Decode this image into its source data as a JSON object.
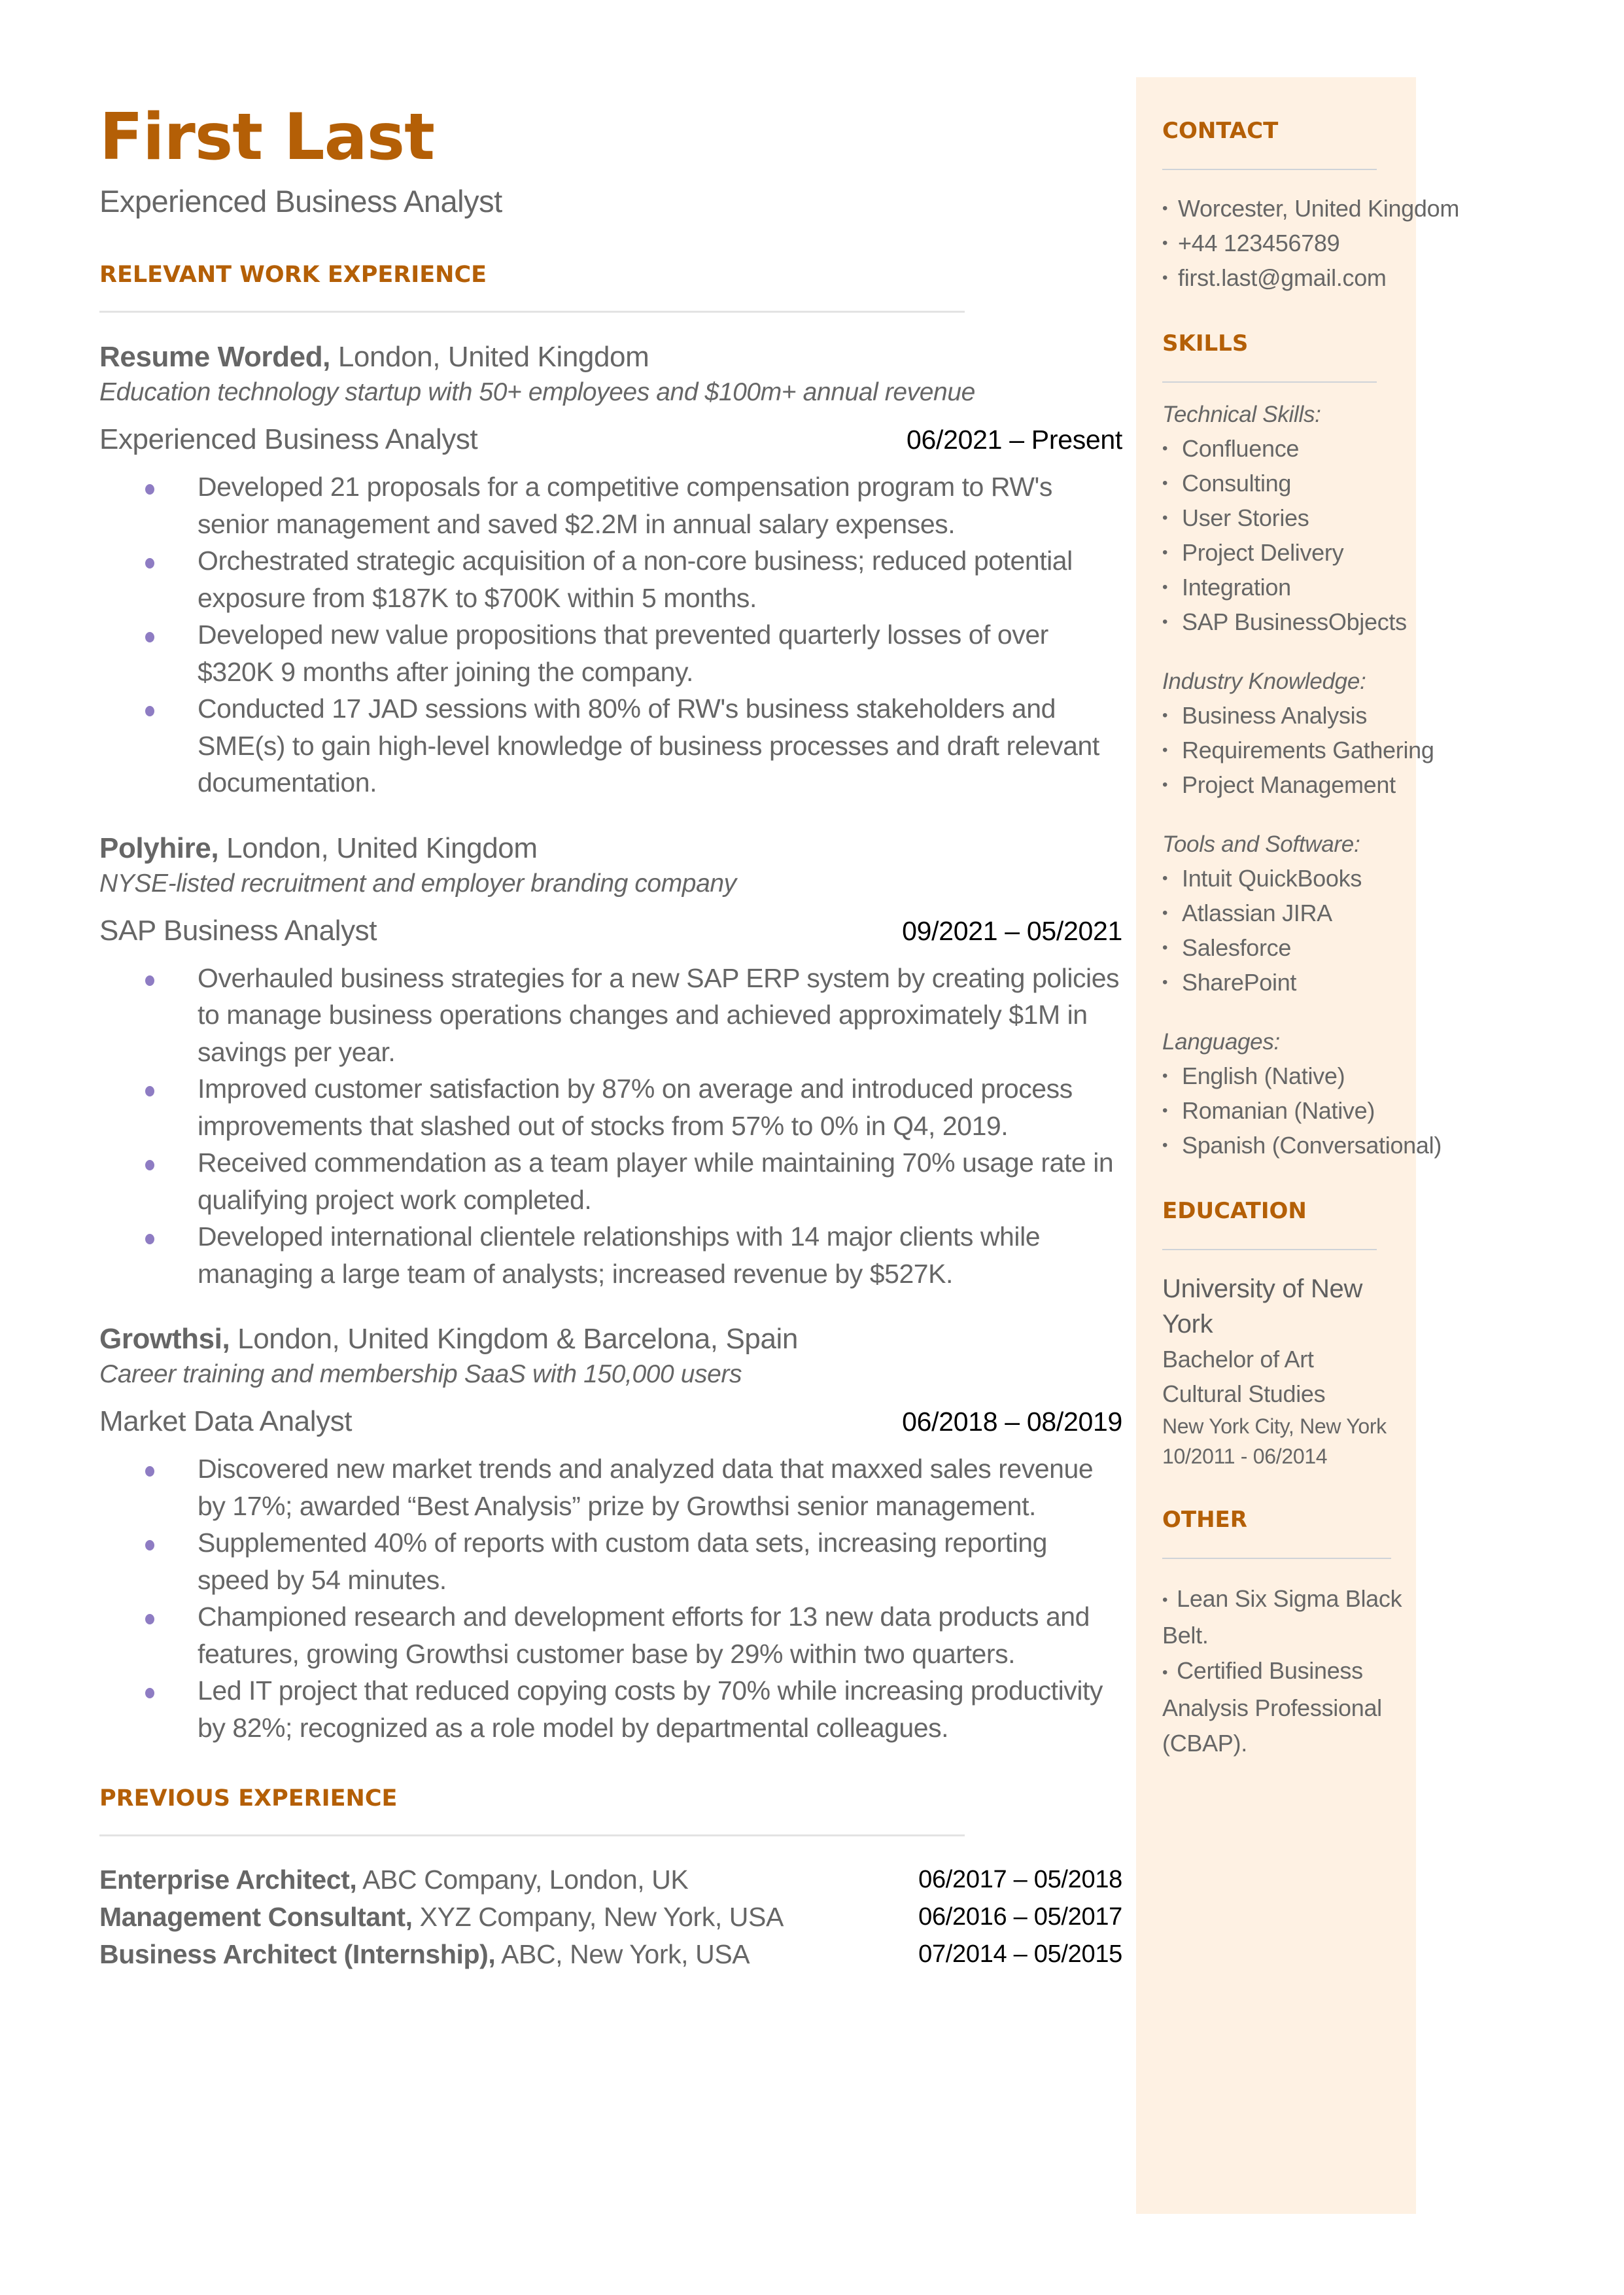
{
  "header": {
    "name": "First Last",
    "title": "Experienced Business Analyst"
  },
  "colors": {
    "accent": "#B45F06",
    "text": "#666666",
    "bullet": "#8E7CC3",
    "sidebar_bg": "#FEF1E3",
    "divider": "#E3E3E3"
  },
  "work": {
    "heading": "RELEVANT WORK EXPERIENCE",
    "jobs": [
      {
        "company": "Resume Worded,",
        "location": " London, United Kingdom",
        "description": "Education technology startup with 50+ employees and $100m+ annual revenue",
        "role": "Experienced Business Analyst",
        "dates": "06/2021 – Present",
        "bullets": [
          "Developed 21 proposals for a competitive compensation program to RW's senior management and saved $2.2M in annual salary expenses.",
          "Orchestrated strategic acquisition of a non-core business; reduced potential exposure from $187K to $700K within 5 months.",
          "Developed new value propositions that prevented quarterly losses of over $320K 9 months after joining the company.",
          "Conducted 17 JAD sessions with 80% of RW's business stakeholders and SME(s) to gain high-level knowledge of business processes and draft relevant documentation."
        ]
      },
      {
        "company": "Polyhire,",
        "location": " London, United Kingdom",
        "description": "NYSE-listed recruitment and employer branding company",
        "role": "SAP Business Analyst",
        "dates": "09/2021 – 05/2021",
        "bullets": [
          "Overhauled business strategies for a new SAP ERP system by creating policies to manage business operations changes and achieved approximately $1M in savings per year.",
          "Improved customer satisfaction by 87% on average and introduced process improvements that slashed out of stocks from 57% to 0% in Q4, 2019.",
          "Received commendation as a team player while maintaining 70% usage rate in qualifying project work completed.",
          "Developed international clientele relationships with 14 major clients while managing a large team of analysts; increased revenue by $527K."
        ]
      },
      {
        "company": "Growthsi,",
        "location": " London, United Kingdom & Barcelona, Spain",
        "description": "Career training and membership SaaS with 150,000 users",
        "role": "Market Data Analyst",
        "dates": "06/2018 – 08/2019",
        "bullets": [
          "Discovered new market trends and analyzed data that maxxed sales revenue by 17%; awarded “Best Analysis” prize by Growthsi senior management.",
          "Supplemented 40% of reports with custom data sets, increasing reporting speed by 54 minutes.",
          "Championed research and development efforts for 13 new data products and features, growing Growthsi customer base by 29% within two quarters.",
          "Led IT project that reduced copying costs by 70% while increasing productivity by 82%; recognized as a role model by departmental colleagues."
        ]
      }
    ]
  },
  "previous": {
    "heading": "PREVIOUS EXPERIENCE",
    "items": [
      {
        "role": "Enterprise Architect,",
        "org": " ABC Company, London, UK",
        "dates": "06/2017 – 05/2018"
      },
      {
        "role": "Management Consultant,",
        "org": " XYZ Company, New York, USA",
        "dates": "06/2016 – 05/2017"
      },
      {
        "role": "Business Architect (Internship),",
        "org": " ABC, New York, USA",
        "dates": "07/2014 – 05/2015"
      }
    ]
  },
  "sidebar": {
    "contact": {
      "heading": "CONTACT",
      "items": [
        "Worcester, United Kingdom",
        "+44 123456789",
        "first.last@gmail.com"
      ]
    },
    "skills": {
      "heading": "SKILLS",
      "groups": [
        {
          "category": "Technical Skills:",
          "items": [
            "Confluence",
            "Consulting",
            "User Stories",
            "Project Delivery",
            "Integration",
            "SAP BusinessObjects"
          ]
        },
        {
          "category": "Industry Knowledge:",
          "items": [
            "Business Analysis",
            "Requirements Gathering",
            "Project Management"
          ]
        },
        {
          "category": "Tools and Software:",
          "items": [
            "Intuit QuickBooks",
            "Atlassian JIRA",
            "Salesforce",
            "SharePoint"
          ]
        },
        {
          "category": "Languages:",
          "items": [
            "English (Native)",
            "Romanian (Native)",
            "Spanish (Conversational)"
          ]
        }
      ]
    },
    "education": {
      "heading": "EDUCATION",
      "school": "University of New York",
      "degree": "Bachelor of Art",
      "field": "Cultural Studies",
      "location": "New York City, New York",
      "dates": "10/2011 - 06/2014"
    },
    "other": {
      "heading": "OTHER",
      "items": [
        "Lean Six Sigma Black Belt.",
        "Certified Business Analysis Professional (CBAP)."
      ]
    }
  }
}
